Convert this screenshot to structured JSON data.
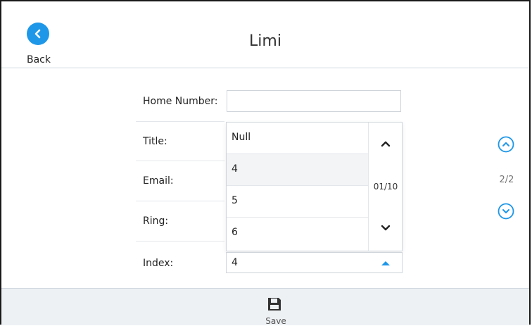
{
  "header": {
    "title": "Limi",
    "back_label": "Back"
  },
  "form": {
    "rows": [
      {
        "label": "Home Number:"
      },
      {
        "label": "Title:"
      },
      {
        "label": "Email:"
      },
      {
        "label": "Ring:"
      },
      {
        "label": "Index:"
      }
    ],
    "home_number_value": ""
  },
  "dropdown": {
    "options": [
      "Null",
      "4",
      "5",
      "6"
    ],
    "selected": "4",
    "position": "01/10"
  },
  "index_field": {
    "value": "4"
  },
  "pager": {
    "indicator": "2/2"
  },
  "footer": {
    "save_label": "Save"
  },
  "colors": {
    "accent": "#1e97e8",
    "footer_bg": "#eef1f4"
  },
  "icons": {
    "back": "chevron-left-icon",
    "scroll_up": "chevron-up-icon",
    "scroll_down": "chevron-down-icon",
    "index_caret": "caret-up-icon",
    "page_up": "circle-chevron-up-icon",
    "page_down": "circle-chevron-down-icon",
    "save": "save-icon"
  }
}
